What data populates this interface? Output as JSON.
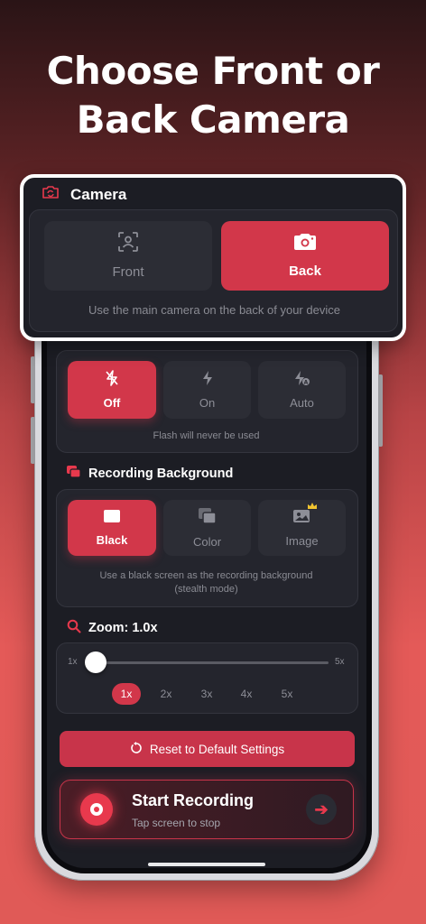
{
  "headline": {
    "line1": "Choose Front or",
    "line2": "Back Camera"
  },
  "camera": {
    "title": "Camera",
    "options": [
      {
        "label": "Front",
        "icon": "portrait-icon",
        "selected": false
      },
      {
        "label": "Back",
        "icon": "camera-icon",
        "selected": true
      }
    ],
    "caption": "Use the main camera on the back of your device"
  },
  "flash": {
    "options": [
      {
        "label": "Off",
        "icon": "flash-off-icon",
        "selected": true
      },
      {
        "label": "On",
        "icon": "flash-on-icon",
        "selected": false
      },
      {
        "label": "Auto",
        "icon": "flash-auto-icon",
        "selected": false
      }
    ],
    "caption": "Flash will never be used"
  },
  "background": {
    "title": "Recording Background",
    "options": [
      {
        "label": "Black",
        "icon": "black-screen-icon",
        "selected": true
      },
      {
        "label": "Color",
        "icon": "color-layers-icon",
        "selected": false
      },
      {
        "label": "Image",
        "icon": "image-icon",
        "selected": false,
        "badge": "crown-icon"
      }
    ],
    "caption_line1": "Use a black screen as the recording background",
    "caption_line2": "(stealth mode)"
  },
  "zoom": {
    "title": "Zoom: 1.0x",
    "min_label": "1x",
    "max_label": "5x",
    "value": 1.0,
    "presets": [
      "1x",
      "2x",
      "3x",
      "4x",
      "5x"
    ],
    "active_preset": "1x"
  },
  "reset_label": "Reset to Default Settings",
  "start": {
    "title": "Start Recording",
    "subtitle": "Tap screen to stop"
  },
  "colors": {
    "accent": "#d2374a",
    "panel": "#24252d",
    "screen": "#1c1d24"
  }
}
